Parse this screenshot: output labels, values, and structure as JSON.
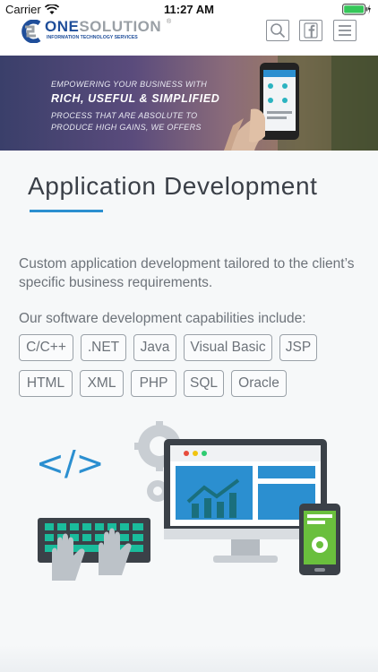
{
  "status_bar": {
    "carrier": "Carrier",
    "time": "11:27 AM"
  },
  "header": {
    "logo": {
      "word_one": "ONE",
      "word_two": "SOLUTION",
      "registered": "®",
      "tagline": "INFORMATION TECHNOLOGY SERVICES"
    },
    "icons": [
      "search-icon",
      "facebook-icon",
      "menu-icon"
    ]
  },
  "banner": {
    "line1": "EMPOWERING YOUR BUSINESS WITH",
    "line2": "RICH, USEFUL & SIMPLIFIED",
    "line3": "PROCESS THAT ARE ABSOLUTE TO",
    "line4": "PRODUCE HIGH GAINS, WE OFFERS"
  },
  "main": {
    "title": "Application Development",
    "description": "Custom application development tailored to the client’s specific business requirements.",
    "capabilities_label": "Our software development capabilities include:",
    "capabilities": [
      "C/C++",
      ".NET",
      "Java",
      "Visual Basic",
      "JSP",
      "HTML",
      "XML",
      "PHP",
      "SQL",
      "Oracle"
    ],
    "illustration_code": "</>"
  },
  "colors": {
    "accent": "#2b8fd0",
    "brand_blue": "#1f4e9a",
    "text_muted": "#6d737a",
    "teal": "#1a6f7d"
  }
}
